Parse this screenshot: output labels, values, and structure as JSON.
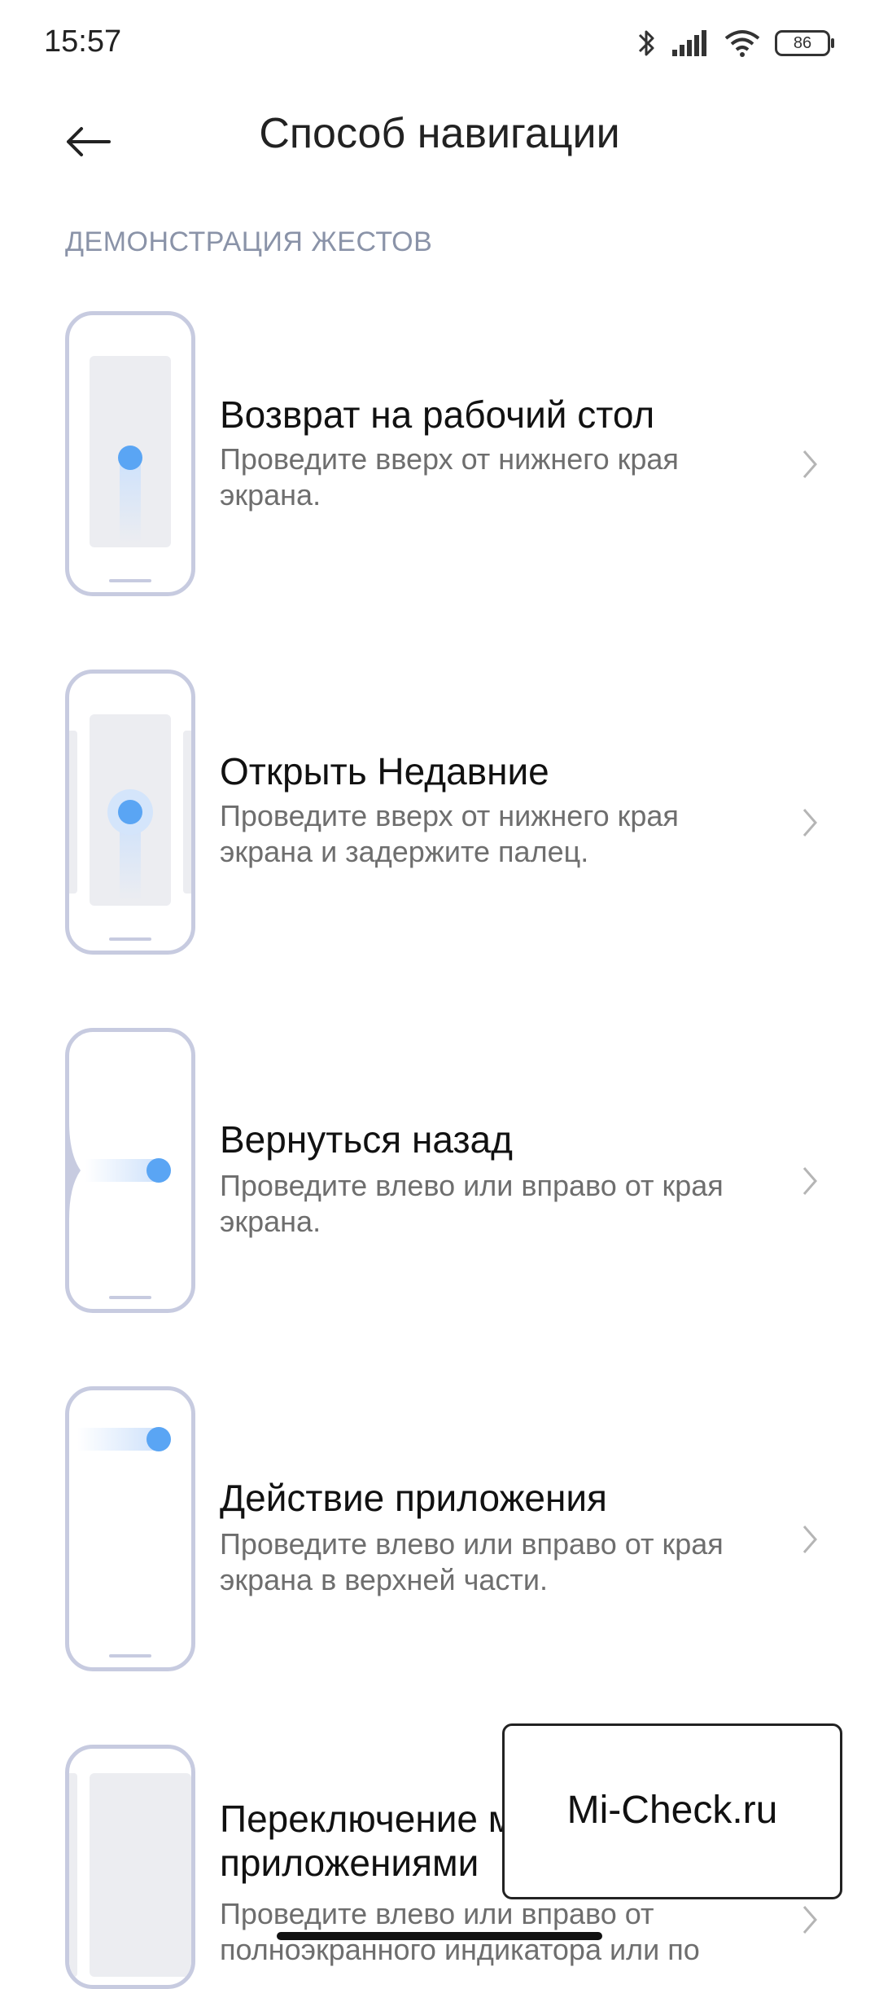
{
  "status": {
    "time": "15:57",
    "battery": "86",
    "icons": [
      "bluetooth-icon",
      "signal-icon",
      "wifi-icon",
      "battery-icon"
    ]
  },
  "header": {
    "title": "Способ навигации",
    "back_icon": "arrow-left-icon"
  },
  "section_label": "ДЕМОНСТРАЦИЯ ЖЕСТОВ",
  "items": [
    {
      "title": "Возврат на рабочий стол",
      "desc": "Проведите вверх от нижнего края экрана."
    },
    {
      "title": "Открыть Недавние",
      "desc": "Проведите вверх от нижнего края экрана и задержите палец."
    },
    {
      "title": "Вернуться назад",
      "desc": "Проведите влево или вправо от края экрана."
    },
    {
      "title": "Действие приложения",
      "desc": "Проведите влево или вправо от края экрана в верхней части."
    },
    {
      "title_line1": "Переключение между",
      "title_line2": "приложениями",
      "desc": "Проведите влево или вправо от полноэкранного индикатора или по"
    }
  ],
  "watermark": "Mi-Check.ru",
  "colors": {
    "accent_dot": "#5aa5f4",
    "phone_outline": "#c7cbe0",
    "section_label": "#8a93a8",
    "desc_text": "#6e6e6e"
  }
}
